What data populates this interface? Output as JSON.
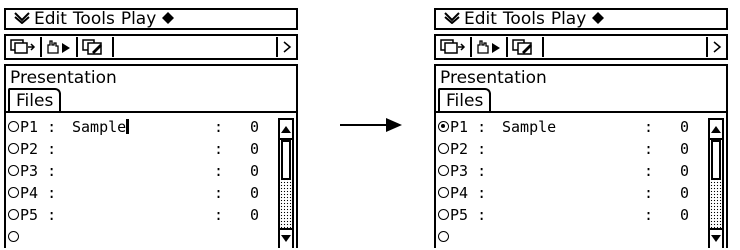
{
  "menubar": {
    "icon": "chevron-down-icon",
    "items": [
      "Edit",
      "Tools",
      "Play"
    ],
    "trailing_icon": "diamond-icon"
  },
  "toolbar": {
    "buttons": [
      "copy-screens-icon",
      "hand-play-icon",
      "edit-screen-icon"
    ],
    "scroll_icon": "right-scroll-icon"
  },
  "left_screen": {
    "title": "Presentation",
    "tab": "Files",
    "rows": [
      {
        "label": "P1",
        "name": "Sample",
        "count": "0",
        "selected": false
      },
      {
        "label": "P2",
        "name": "",
        "count": "0",
        "selected": false
      },
      {
        "label": "P3",
        "name": "",
        "count": "0",
        "selected": false
      },
      {
        "label": "P4",
        "name": "",
        "count": "0",
        "selected": false
      },
      {
        "label": "P5",
        "name": "",
        "count": "0",
        "selected": false
      }
    ]
  },
  "right_screen": {
    "title": "Presentation",
    "tab": "Files",
    "rows": [
      {
        "label": "P1",
        "name": "Sample",
        "count": "0",
        "selected": true
      },
      {
        "label": "P2",
        "name": "",
        "count": "0",
        "selected": false
      },
      {
        "label": "P3",
        "name": "",
        "count": "0",
        "selected": false
      },
      {
        "label": "P4",
        "name": "",
        "count": "0",
        "selected": false
      },
      {
        "label": "P5",
        "name": "",
        "count": "0",
        "selected": false
      }
    ]
  },
  "colors": {
    "foreground": "#000000",
    "background": "#ffffff"
  }
}
